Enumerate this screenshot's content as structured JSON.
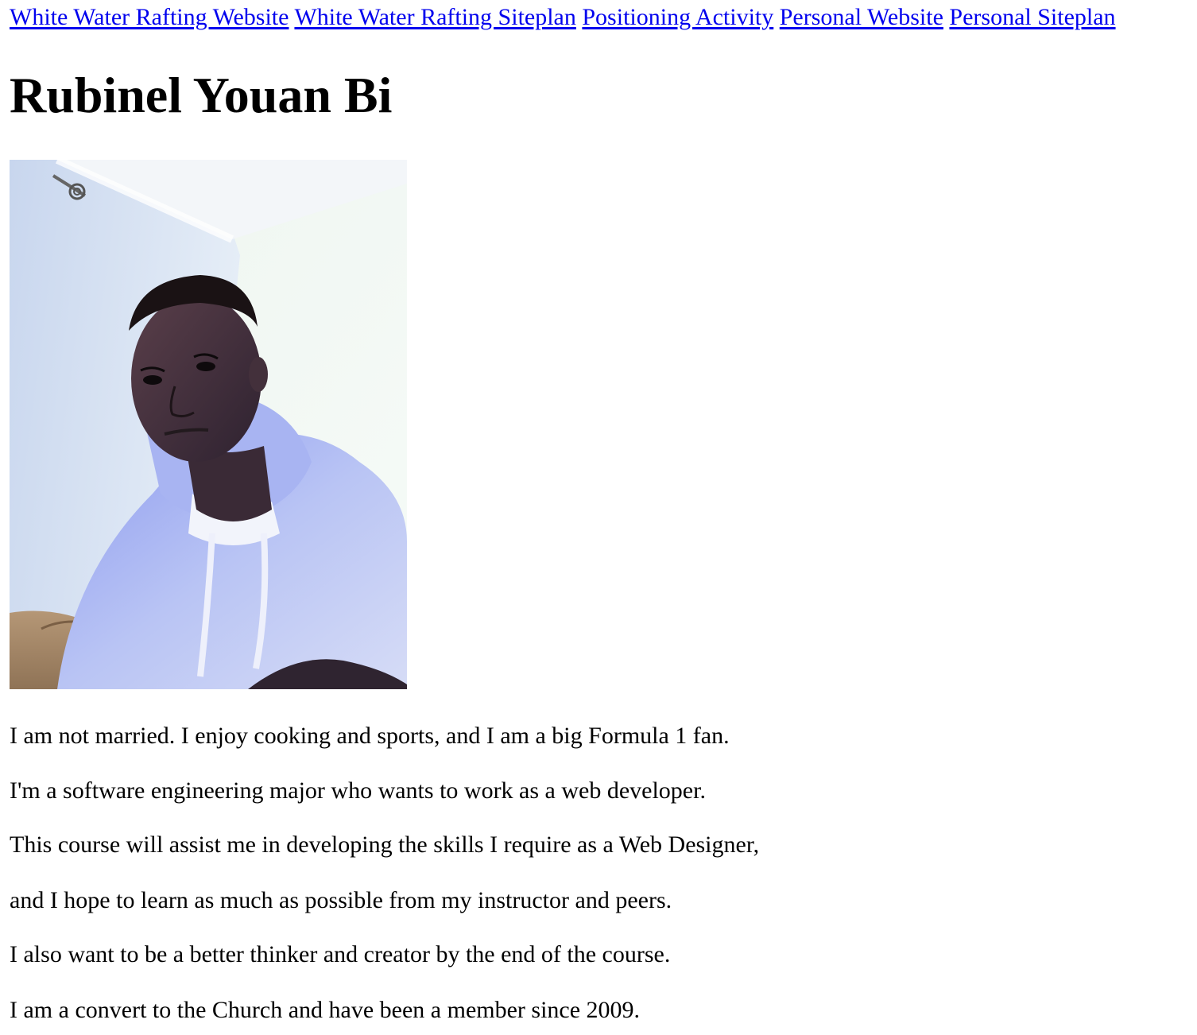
{
  "nav": {
    "links": [
      {
        "label": "White Water Rafting Website"
      },
      {
        "label": "White Water Rafting Siteplan"
      },
      {
        "label": "Positioning Activity"
      },
      {
        "label": "Personal Website"
      },
      {
        "label": "Personal Siteplan"
      }
    ]
  },
  "header": {
    "name": "Rubinel Youan Bi"
  },
  "bio": {
    "paragraphs": [
      "I am not married. I enjoy cooking and sports, and I am a big Formula 1 fan.",
      "I'm a software engineering major who wants to work as a web developer.",
      "This course will assist me in developing the skills I require as a Web Designer,",
      "and I hope to learn as much as possible from my instructor and peers.",
      "I also want to be a better thinker and creator by the end of the course.",
      "I am a convert to the Church and have been a member since 2009."
    ]
  },
  "colors": {
    "link": "#0000ee",
    "text": "#000000",
    "background": "#ffffff"
  }
}
